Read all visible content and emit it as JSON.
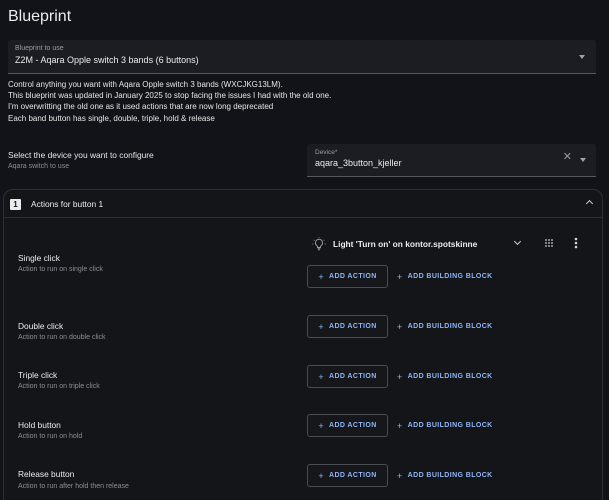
{
  "page": {
    "title": "Blueprint"
  },
  "blueprint_select": {
    "label": "Blueprint to use",
    "value": "Z2M - Aqara Opple switch 3 bands (6 buttons)"
  },
  "description": [
    "Control anything you want with Aqara Opple switch 3 bands (WXCJKG13LM).",
    "This blueprint was updated in January 2025 to stop facing the issues I had with the old one.",
    "I'm overwritting the old one as it used actions that are now long deprecated",
    "Each band button has single, double, triple, hold & release"
  ],
  "device": {
    "title": "Select the device you want to configure",
    "subtitle": "Aqara switch to use",
    "field_label": "Device*",
    "value": "aqara_3button_kjeller",
    "clear_icon": "close-icon"
  },
  "section": {
    "number": "1",
    "title": "Actions for button 1",
    "existing_action": {
      "text": "Light 'Turn on' on kontor.spotskinne",
      "icon": "lightbulb-icon"
    },
    "rows": [
      {
        "label": "Single click",
        "sub": "Action to run on single click"
      },
      {
        "label": "Double click",
        "sub": "Action to run on double click"
      },
      {
        "label": "Triple click",
        "sub": "Action to run on triple click"
      },
      {
        "label": "Hold button",
        "sub": "Action to run on hold"
      },
      {
        "label": "Release button",
        "sub": "Action to run after hold then release"
      }
    ],
    "add_action_label": "ADD ACTION",
    "add_block_label": "ADD BUILDING BLOCK"
  },
  "colors": {
    "background": "#111318",
    "field": "#1b1d23",
    "accent": "#8fb4f5"
  }
}
